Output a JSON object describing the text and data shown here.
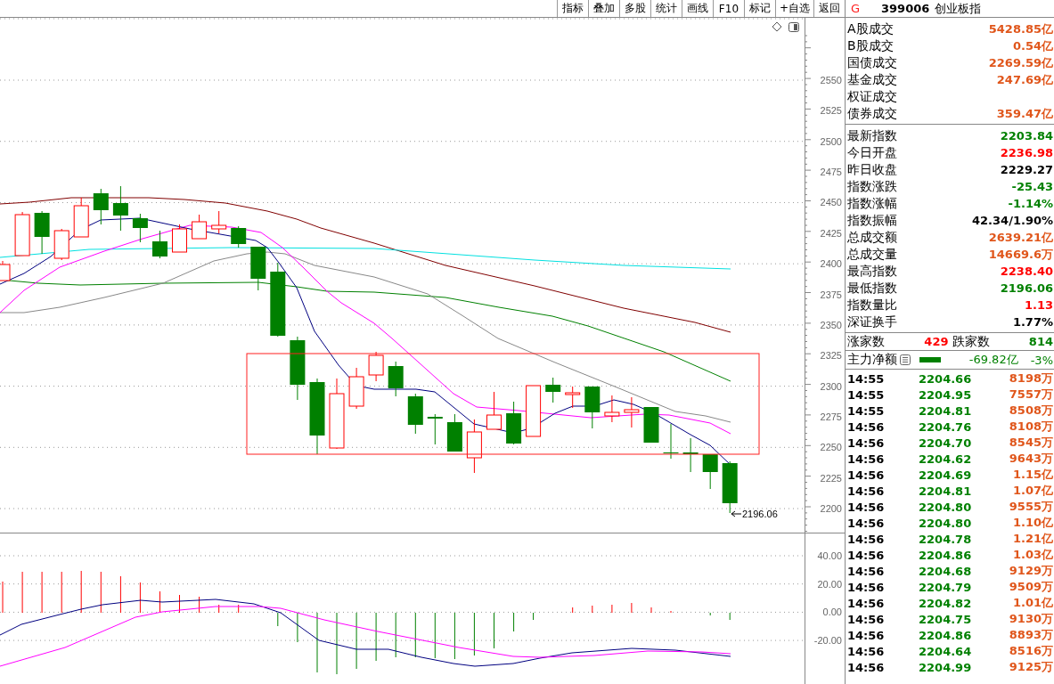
{
  "toolbar": {
    "buttons": [
      "指标",
      "叠加",
      "多股",
      "统计",
      "画线",
      "F10",
      "标记",
      "+自选",
      "返回"
    ]
  },
  "main_chart": {
    "price_axis": [
      "2550",
      "2525",
      "2500",
      "2475",
      "2450",
      "2425",
      "2400",
      "2375",
      "2350",
      "2325",
      "2300",
      "2275",
      "2250",
      "2225",
      "2200"
    ],
    "low_marker": "2196.06"
  },
  "indicator_chart": {
    "axis": [
      "40.00",
      "20.00",
      "0.00",
      "-20.00"
    ]
  },
  "quote_panel": {
    "badge": "G",
    "code": "399006",
    "name": "创业板指",
    "turnover": [
      {
        "label": "A股成交",
        "value": "5428.85亿",
        "color": "#e0561b"
      },
      {
        "label": "B股成交",
        "value": "0.54亿",
        "color": "#e0561b"
      },
      {
        "label": "国债成交",
        "value": "2269.59亿",
        "color": "#e0561b"
      },
      {
        "label": "基金成交",
        "value": "247.69亿",
        "color": "#e0561b"
      },
      {
        "label": "权证成交"
      },
      {
        "label": "债券成交",
        "value": "359.47亿",
        "color": "#e0561b"
      }
    ],
    "index_stats": [
      {
        "label": "最新指数",
        "value": "2203.84",
        "color": "#008000"
      },
      {
        "label": "今日开盘",
        "value": "2236.98",
        "color": "#ff0000"
      },
      {
        "label": "昨日收盘",
        "value": "2229.27",
        "color": "#000000"
      },
      {
        "label": "指数涨跌",
        "value": "-25.43",
        "color": "#008000"
      },
      {
        "label": "指数涨幅",
        "value": "-1.14%",
        "color": "#008000"
      },
      {
        "label": "指数振幅",
        "value": "42.34/1.90%",
        "color": "#000000"
      },
      {
        "label": "总成交额",
        "value": "2639.21亿",
        "color": "#e0561b"
      },
      {
        "label": "总成交量",
        "value": "14669.6万",
        "color": "#e0561b"
      },
      {
        "label": "最高指数",
        "value": "2238.40",
        "color": "#ff0000"
      },
      {
        "label": "最低指数",
        "value": "2196.06",
        "color": "#008000"
      },
      {
        "label": "指数量比",
        "value": "1.13",
        "color": "#ff0000"
      },
      {
        "label": "深证换手",
        "value": "1.77%",
        "color": "#000000"
      }
    ],
    "breadth": {
      "up_label": "涨家数",
      "up_count": "429",
      "down_label": "跌家数",
      "down_count": "814"
    },
    "main_flow": {
      "label": "主力净额",
      "amount": "-69.82亿",
      "percent": "-3%"
    },
    "ticks": [
      {
        "time": "14:55",
        "price": "2204.66",
        "amount": "8198万"
      },
      {
        "time": "14:55",
        "price": "2204.95",
        "amount": "7557万"
      },
      {
        "time": "14:55",
        "price": "2204.81",
        "amount": "8508万"
      },
      {
        "time": "14:56",
        "price": "2204.76",
        "amount": "8108万"
      },
      {
        "time": "14:56",
        "price": "2204.70",
        "amount": "8545万"
      },
      {
        "time": "14:56",
        "price": "2204.62",
        "amount": "9643万"
      },
      {
        "time": "14:56",
        "price": "2204.69",
        "amount": "1.15亿"
      },
      {
        "time": "14:56",
        "price": "2204.81",
        "amount": "1.07亿"
      },
      {
        "time": "14:56",
        "price": "2204.80",
        "amount": "9555万"
      },
      {
        "time": "14:56",
        "price": "2204.80",
        "amount": "1.10亿"
      },
      {
        "time": "14:56",
        "price": "2204.78",
        "amount": "1.21亿"
      },
      {
        "time": "14:56",
        "price": "2204.86",
        "amount": "1.03亿"
      },
      {
        "time": "14:56",
        "price": "2204.68",
        "amount": "9129万"
      },
      {
        "time": "14:56",
        "price": "2204.79",
        "amount": "9509万"
      },
      {
        "time": "14:56",
        "price": "2204.82",
        "amount": "1.01亿"
      },
      {
        "time": "14:56",
        "price": "2204.75",
        "amount": "9130万"
      },
      {
        "time": "14:56",
        "price": "2204.86",
        "amount": "8893万"
      },
      {
        "time": "14:56",
        "price": "2204.64",
        "amount": "8516万"
      },
      {
        "time": "14:56",
        "price": "2204.99",
        "amount": "9125万"
      }
    ]
  }
}
